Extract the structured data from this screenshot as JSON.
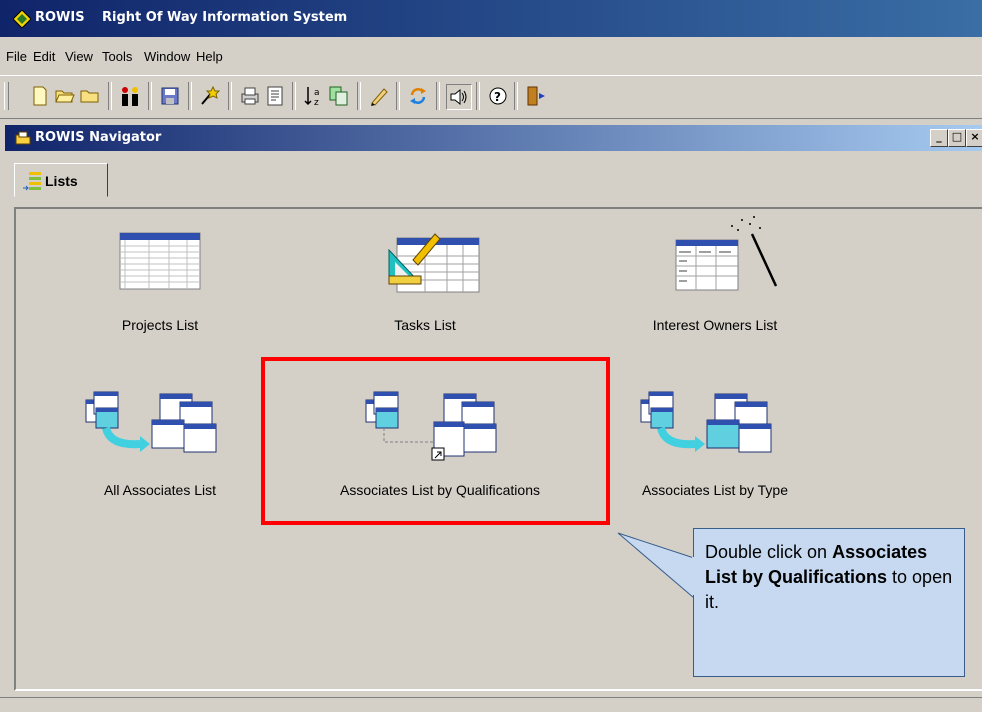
{
  "app": {
    "name": "ROWIS",
    "title": "Right Of Way Information System"
  },
  "menu": [
    "File",
    "Edit",
    "View",
    "Tools",
    "Window",
    "Help"
  ],
  "toolbar_icons": [
    "new-icon",
    "open-folder-icon",
    "folder-icon",
    "people-icon",
    "save-icon",
    "wizard-icon",
    "print-icon",
    "report-icon",
    "sort-az-icon",
    "copy-icon",
    "edit-pencil-icon",
    "refresh-icon",
    "sound-icon",
    "help-icon",
    "exit-door-icon"
  ],
  "navigator": {
    "title": "ROWIS Navigator",
    "tab_label": "Lists",
    "items": [
      {
        "label": "Projects List"
      },
      {
        "label": "Tasks List"
      },
      {
        "label": "Interest Owners List"
      },
      {
        "label": "All Associates List"
      },
      {
        "label": "Associates List by Qualifications"
      },
      {
        "label": "Associates List by Type"
      }
    ]
  },
  "callout": {
    "line1": "Double click on ",
    "bold": "Associates List by Qualifications",
    "line2": " to open it."
  },
  "colors": {
    "highlight": "#ff0000",
    "callout_fill": "#c6d9f1",
    "titlebar": "#10246a"
  }
}
